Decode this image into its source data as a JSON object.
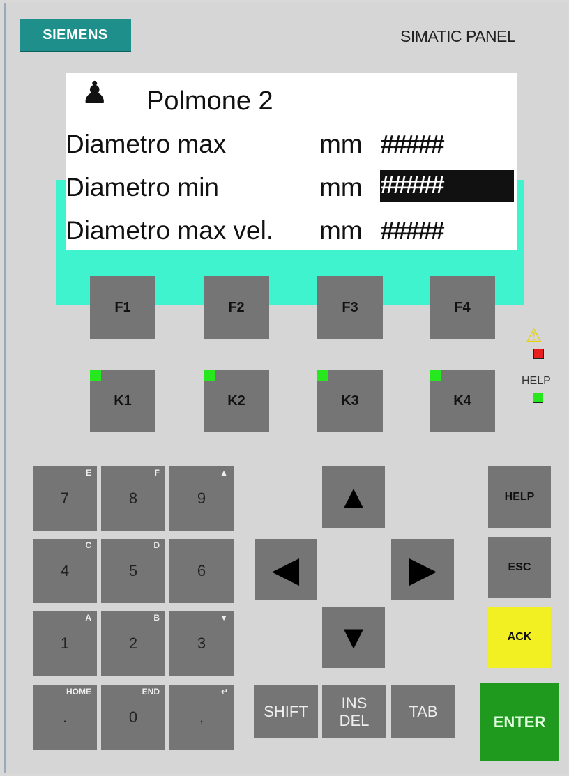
{
  "brand": {
    "logo": "SIEMENS",
    "title": "SIMATIC PANEL"
  },
  "screen": {
    "title": "Polmone 2",
    "rows": [
      {
        "label": "Diametro max",
        "unit": "mm",
        "value": "#####"
      },
      {
        "label": "Diametro min",
        "unit": "mm",
        "value": "#####"
      },
      {
        "label": "Diametro max vel.",
        "unit": "mm",
        "value": "#####"
      }
    ]
  },
  "function_keys": [
    "F1",
    "F2",
    "F3",
    "F4"
  ],
  "soft_keys": [
    "K1",
    "K2",
    "K3",
    "K4"
  ],
  "indicators": {
    "help_label": "HELP"
  },
  "keypad": {
    "row1": [
      {
        "main": "7",
        "sub": "E"
      },
      {
        "main": "8",
        "sub": "F"
      },
      {
        "main": "9",
        "sub": "▲"
      }
    ],
    "row2": [
      {
        "main": "4",
        "sub": "C"
      },
      {
        "main": "5",
        "sub": "D"
      },
      {
        "main": "6",
        "sub": ""
      }
    ],
    "row3": [
      {
        "main": "1",
        "sub": "A"
      },
      {
        "main": "2",
        "sub": "B"
      },
      {
        "main": "3",
        "sub": "▼"
      }
    ],
    "row4": [
      {
        "main": ".",
        "sub": "HOME"
      },
      {
        "main": "0",
        "sub": "END"
      },
      {
        "main": ",",
        "sub": "↵"
      }
    ]
  },
  "nav": {
    "up": "▲",
    "down": "▼",
    "left": "◀",
    "right": "▶"
  },
  "bottom_keys": {
    "shift": "SHIFT",
    "ins": "INS",
    "del": "DEL",
    "tab": "TAB"
  },
  "side_keys": {
    "help": "HELP",
    "esc": "ESC",
    "ack": "ACK",
    "enter": "ENTER"
  },
  "colors": {
    "ack": "#f2ef22",
    "enter": "#1f9a1f",
    "led": "#27e81f",
    "screen_bezel": "#3ff3cf",
    "logo": "#1e8f8a"
  }
}
